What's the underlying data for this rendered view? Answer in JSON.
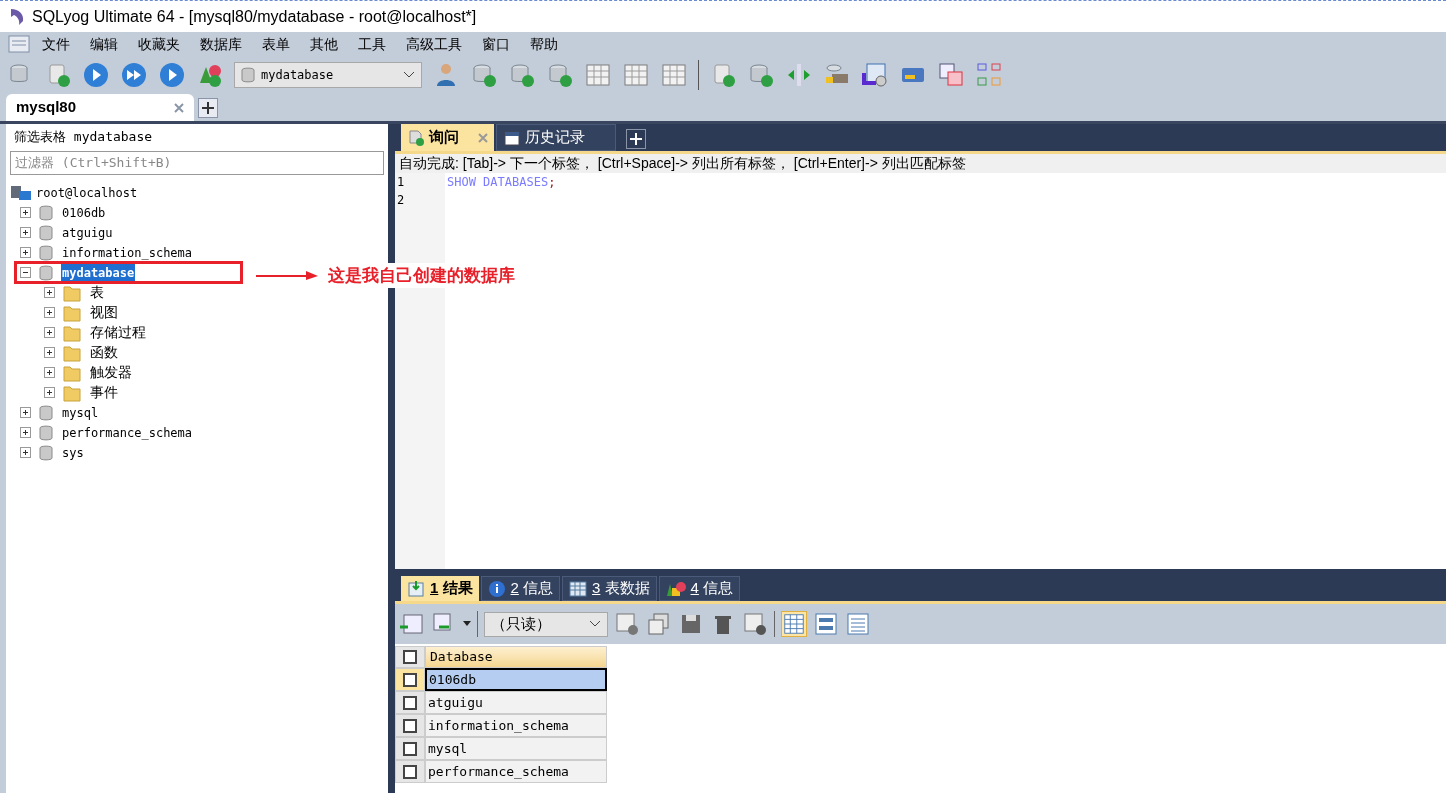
{
  "window": {
    "title": "SQLyog Ultimate 64 - [mysql80/mydatabase - root@localhost*]"
  },
  "menu": [
    "文件",
    "编辑",
    "收藏夹",
    "数据库",
    "表单",
    "其他",
    "工具",
    "高级工具",
    "窗口",
    "帮助"
  ],
  "toolbar": {
    "database_select": "mydatabase"
  },
  "connection_tabs": [
    {
      "label": "mysql80",
      "selected": true
    }
  ],
  "object_browser": {
    "filter_label": "筛选表格 mydatabase",
    "filter_placeholder": "过滤器 (Ctrl+Shift+B)",
    "tree": {
      "label": "root@localhost",
      "children": [
        {
          "label": "0106db",
          "kind": "database",
          "expanded": false,
          "selected": false
        },
        {
          "label": "atguigu",
          "kind": "database",
          "expanded": false,
          "selected": false
        },
        {
          "label": "information_schema",
          "kind": "database",
          "expanded": false,
          "selected": false
        },
        {
          "label": "mydatabase",
          "kind": "database",
          "expanded": true,
          "selected": true,
          "children": [
            {
              "label": "表",
              "kind": "folder",
              "expanded": false,
              "selected": false
            },
            {
              "label": "视图",
              "kind": "folder",
              "expanded": false,
              "selected": false
            },
            {
              "label": "存储过程",
              "kind": "folder",
              "expanded": false,
              "selected": false
            },
            {
              "label": "函数",
              "kind": "folder",
              "expanded": false,
              "selected": false
            },
            {
              "label": "触发器",
              "kind": "folder",
              "expanded": false,
              "selected": false
            },
            {
              "label": "事件",
              "kind": "folder",
              "expanded": false,
              "selected": false
            }
          ]
        },
        {
          "label": "mysql",
          "kind": "database",
          "expanded": false,
          "selected": false
        },
        {
          "label": "performance_schema",
          "kind": "database",
          "expanded": false,
          "selected": false
        },
        {
          "label": "sys",
          "kind": "database",
          "expanded": false,
          "selected": false
        }
      ]
    }
  },
  "annotation": {
    "text": "这是我自己创建的数据库"
  },
  "query_tabs": [
    {
      "label": "询问",
      "kind": "query",
      "selected": true
    },
    {
      "label": "历史记录",
      "kind": "history",
      "selected": false
    }
  ],
  "autocomplete_hint": "自动完成: [Tab]-> 下一个标签， [Ctrl+Space]-> 列出所有标签， [Ctrl+Enter]-> 列出匹配标签",
  "editor": {
    "lines": [
      {
        "number": "1",
        "tokens": [
          {
            "text": "SHOW DATABASES",
            "kind": "keyword"
          },
          {
            "text": ";",
            "kind": "punct"
          }
        ]
      },
      {
        "number": "2"
      }
    ]
  },
  "result_tabs": [
    {
      "number": "1",
      "label": "结果",
      "kind": "result",
      "selected": true
    },
    {
      "number": "2",
      "label": "信息",
      "kind": "info",
      "selected": false
    },
    {
      "number": "3",
      "label": "表数据",
      "kind": "table",
      "selected": false
    },
    {
      "number": "4",
      "label": "信息",
      "kind": "profile",
      "selected": false
    }
  ],
  "result_toolbar": {
    "mode_select": "（只读）"
  },
  "result_grid": {
    "columns": [
      "Database"
    ],
    "all_checked": false,
    "rows": [
      {
        "cells": [
          "0106db"
        ],
        "selected": true,
        "checked": false
      },
      {
        "cells": [
          "atguigu"
        ],
        "selected": false,
        "checked": false
      },
      {
        "cells": [
          "information_schema"
        ],
        "selected": false,
        "checked": false
      },
      {
        "cells": [
          "mysql"
        ],
        "selected": false,
        "checked": false
      },
      {
        "cells": [
          "performance_schema"
        ],
        "selected": false,
        "checked": false
      }
    ]
  }
}
